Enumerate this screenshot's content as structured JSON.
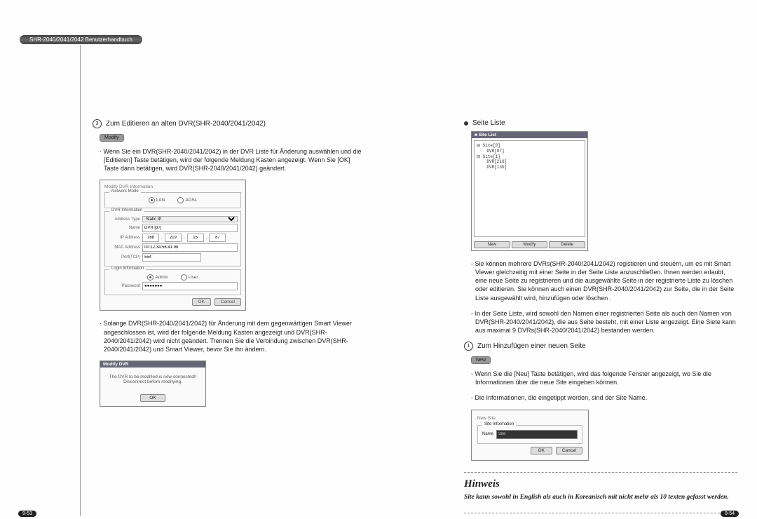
{
  "header": "SHR-2040/2041/2042 Benutzerhandbuch",
  "pagenum_left": "9-53",
  "pagenum_right": "9-54",
  "left": {
    "item3_num": "3",
    "item3_title": "Zum Editieren an alten DVR(SHR-2040/2041/2042)",
    "btn_modify": "Modify",
    "p1": "· Wenn Sie ein DVR(SHR-2040/2041/2042) in der DVR Liste für Änderung auswählen und die [Editieren] Taste betätigen, wird der folgende Meldung Kasten angezeigt. Wenn Sie [OK] Taste dann betätigen, wird DVR(SHR-2040/2041/2042) geändert.",
    "p2": "· Solange DVR(SHR-2040/2041/2042) für Änderung mit dem gegenwärtigen Smart Viewer angeschlossen ist, wird der folgende Meldung Kasten angezeigt und DVR(SHR-2040/2041/2042) wird nicht geändert. Trennen Sie die Verbindung zwischen DVR(SHR-2040/2041/2042) und Smart Viewer, bevor Sie ihn ändern.",
    "modifyDialog": {
      "title": "Modify DVR Information",
      "group_net": "Network Mode",
      "opt_lan": "LAN",
      "opt_adsl": "ADSL",
      "group_dvr": "DVR Information",
      "lbl_addrtype": "Address Type",
      "val_addrtype": "Static IP",
      "lbl_name": "Name",
      "val_name": "DVR [87]",
      "lbl_ip": "IP Address",
      "ip": [
        "168",
        "219",
        "15",
        "87"
      ],
      "lbl_mac": "MAC Address",
      "val_mac": "00:12:34:56:41:98",
      "lbl_port": "Port(TCP)",
      "val_port": "554",
      "group_login": "Login Information",
      "opt_admin": "Admin",
      "opt_user": "User",
      "lbl_pwd": "Password",
      "val_pwd": "●●●●●●●",
      "btn_ok": "OK",
      "btn_cancel": "Cancel"
    },
    "warnDialog": {
      "title": "Modify DVR",
      "msg1": "The DVR to be modified is now connected!!",
      "msg2": "Disconnect before modifying.",
      "btn_ok": "OK"
    }
  },
  "right": {
    "section_title": "Seite Liste",
    "sitelist": {
      "title": "Site List",
      "tree": "⊟ Site[0]\n    DVR[87]\n⊟ Site[1]\n    DVR[216]\n    DVR[130]",
      "btn_new": "New",
      "btn_mod": "Modify",
      "btn_del": "Delete"
    },
    "p1": "- Sie können mehrere DVRs(SHR-2040/2041/2042) registieren und steuern, um es mit Smart Viewer gleichzeitig mit einer Seite in der Seite Liste anzuschließen. Ihnen werden erlaubt, eine neue Seite zu registrieren und die ausgewählte Seite in der registrierte Liste zu löschen oder editieren. Sie können auch einen DVR(SHR-2040/2041/2042) zur Seite, die in der Seite Liste ausgewählt wird, hinzufügen oder löschen .",
    "p2": "- In der Seite Liste, wird sowohl den Namen einer registrierten Seite als auch den Namen von DVR(SHR-2040/2041/2042), die aus Seite besteht, mit einer Liste angezeigt. Eine Siete kann aus maximal 9 DVRs(SHR-2040/2041/2042) bestanden werden.",
    "item1_num": "1",
    "item1_title": "Zum Hinzufügen einer neuen Seite",
    "btn_new2": "New",
    "p3": "- Wenn Sie die [Neu] Taste betätigen, wird das folgende Fenster angezeigt, wo Sie die Informationen über die neue Site eingeben können.",
    "p4": "- Die Informationen, die eingetippt werden, sind der Site Name.",
    "newsite": {
      "title": "New Site",
      "group": "Site Information",
      "lbl_name": "Name",
      "val_name": "Site",
      "btn_ok": "OK",
      "btn_cancel": "Cancel"
    },
    "hinweis_t": "Hinweis",
    "hinweis_p": "Site kann sowohl in English als auch in Koreanisch mit nicht mehr als 10 texten gefasst werden."
  }
}
